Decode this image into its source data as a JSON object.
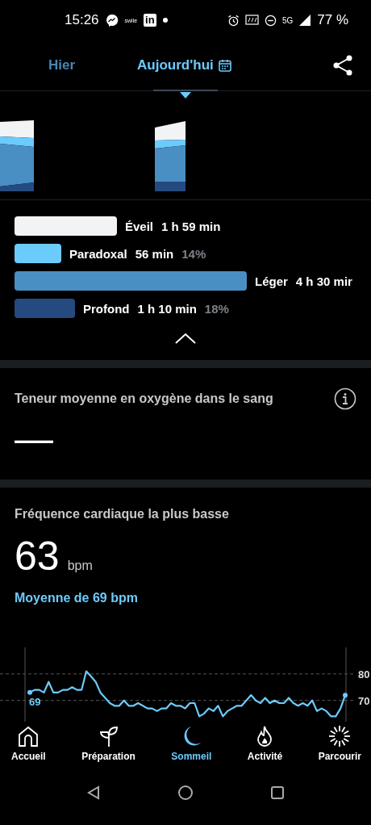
{
  "status_bar": {
    "time": "15:26",
    "app_label": "swile",
    "linkedin": "in",
    "network": "5G",
    "battery": "77 %"
  },
  "tabs": [
    {
      "label": "Hier",
      "selected": false
    },
    {
      "label": "Aujourd'hui",
      "selected": true
    }
  ],
  "stages": [
    {
      "name": "Éveil",
      "duration": "1 h 59 min",
      "color": "#f2f3f5"
    },
    {
      "name": "Paradoxal",
      "duration": "56 min",
      "percent": "14%",
      "color": "#6ccbfd"
    },
    {
      "name": "Léger",
      "duration": "4 h 30 mir",
      "color": "#4a8fc4"
    },
    {
      "name": "Profond",
      "duration": "1 h 10 min",
      "percent": "18%",
      "color": "#244a80"
    }
  ],
  "oxygen": {
    "title": "Teneur moyenne en oxygène dans le sang",
    "value": "—"
  },
  "heart_rate": {
    "title": "Fréquence cardiaque la plus basse",
    "value": "63",
    "unit": "bpm",
    "average": "Moyenne de 69 bpm",
    "chart_data": {
      "type": "line",
      "ylim": [
        62,
        90
      ],
      "yticks": [
        70,
        80
      ],
      "annotations": [
        "69"
      ],
      "series": [
        {
          "color": "#6ccbfd",
          "values": [
            73,
            74,
            74,
            73,
            77,
            73,
            73,
            74,
            74,
            75,
            74,
            74,
            81,
            79,
            77,
            73,
            71,
            69,
            68,
            68,
            70,
            68,
            68,
            69,
            68,
            67,
            67,
            66,
            67,
            67,
            69,
            68,
            68,
            67,
            69,
            69,
            64,
            65,
            67,
            66,
            68,
            64,
            66,
            67,
            68,
            68,
            70,
            72,
            70,
            69,
            71,
            69,
            70,
            69,
            69,
            71,
            69,
            68,
            69,
            68,
            70,
            66,
            67,
            66,
            64,
            64,
            67,
            72
          ]
        }
      ]
    }
  },
  "nav": [
    {
      "label": "Accueil",
      "selected": false
    },
    {
      "label": "Préparation",
      "selected": false
    },
    {
      "label": "Sommeil",
      "selected": true
    },
    {
      "label": "Activité",
      "selected": false
    },
    {
      "label": "Parcourir",
      "selected": false
    }
  ]
}
